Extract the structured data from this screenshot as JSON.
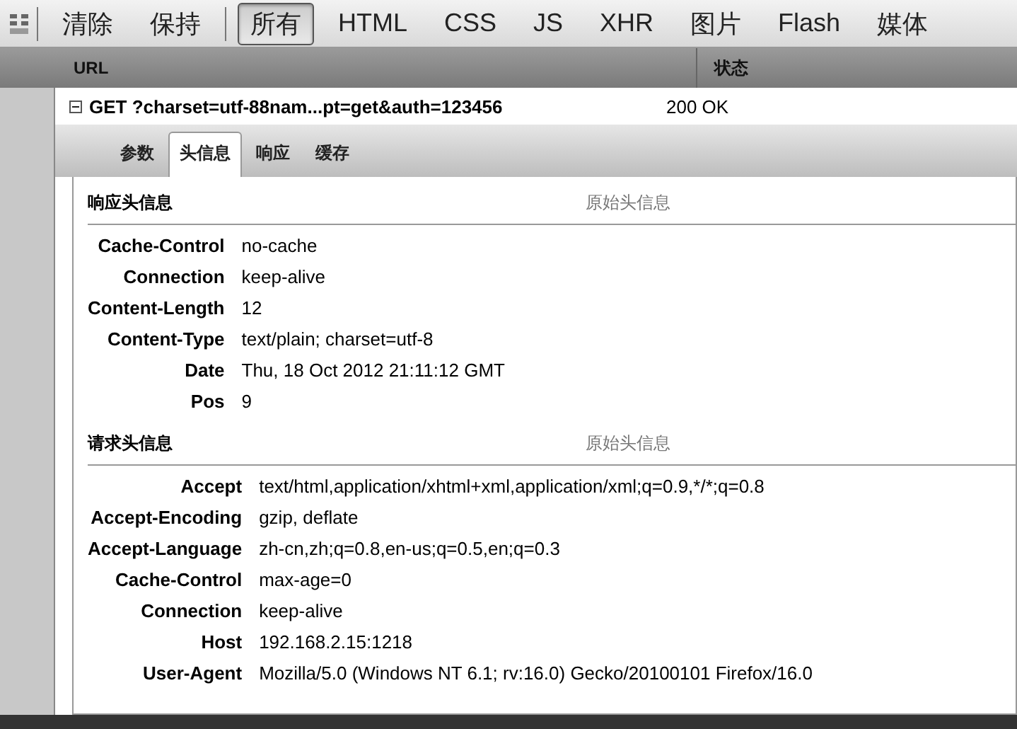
{
  "toolbar": {
    "buttons": [
      {
        "label": "清除",
        "selected": false
      },
      {
        "label": "保持",
        "selected": false
      },
      {
        "label": "所有",
        "selected": true
      },
      {
        "label": "HTML",
        "selected": false
      },
      {
        "label": "CSS",
        "selected": false
      },
      {
        "label": "JS",
        "selected": false
      },
      {
        "label": "XHR",
        "selected": false
      },
      {
        "label": "图片",
        "selected": false
      },
      {
        "label": "Flash",
        "selected": false
      },
      {
        "label": "媒体",
        "selected": false
      }
    ]
  },
  "table": {
    "columns": [
      "URL",
      "状态"
    ],
    "request": {
      "expanded": true,
      "url": "GET ?charset=utf-88nam...pt=get&auth=123456",
      "status": "200 OK"
    }
  },
  "detail_tabs": [
    {
      "label": "参数",
      "selected": false
    },
    {
      "label": "头信息",
      "selected": true
    },
    {
      "label": "响应",
      "selected": false
    },
    {
      "label": "缓存",
      "selected": false
    }
  ],
  "sections": [
    {
      "title": "响应头信息",
      "link": "原始头信息",
      "headers": [
        {
          "name": "Cache-Control",
          "value": "no-cache"
        },
        {
          "name": "Connection",
          "value": "keep-alive"
        },
        {
          "name": "Content-Length",
          "value": "12"
        },
        {
          "name": "Content-Type",
          "value": "text/plain; charset=utf-8"
        },
        {
          "name": "Date",
          "value": "Thu, 18 Oct 2012 21:11:12 GMT"
        },
        {
          "name": "Pos",
          "value": "9"
        }
      ]
    },
    {
      "title": "请求头信息",
      "link": "原始头信息",
      "headers": [
        {
          "name": "Accept",
          "value": "text/html,application/xhtml+xml,application/xml;q=0.9,*/*;q=0.8"
        },
        {
          "name": "Accept-Encoding",
          "value": "gzip, deflate"
        },
        {
          "name": "Accept-Language",
          "value": "zh-cn,zh;q=0.8,en-us;q=0.5,en;q=0.3"
        },
        {
          "name": "Cache-Control",
          "value": "max-age=0"
        },
        {
          "name": "Connection",
          "value": "keep-alive"
        },
        {
          "name": "Host",
          "value": "192.168.2.15:1218"
        },
        {
          "name": "User-Agent",
          "value": "Mozilla/5.0 (Windows NT 6.1; rv:16.0) Gecko/20100101 Firefox/16.0"
        }
      ]
    }
  ]
}
